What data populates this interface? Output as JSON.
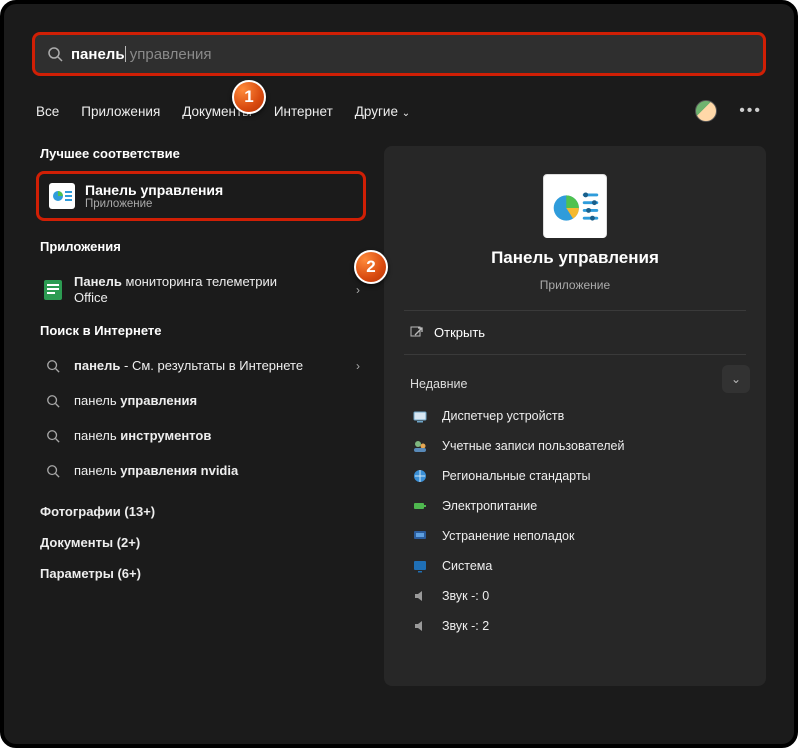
{
  "search": {
    "typed_bold": "панель",
    "typed_rest": "",
    "suggestion_rest": " управления"
  },
  "tabs": {
    "all": "Все",
    "apps": "Приложения",
    "docs": "Документы",
    "web": "Интернет",
    "other": "Другие"
  },
  "left": {
    "best_label": "Лучшее соответствие",
    "best_title_bold": "Панель",
    "best_title_rest": " управления",
    "best_sub": "Приложение",
    "apps_label": "Приложения",
    "app1_bold": "Панель",
    "app1_rest": " мониторинга телеметрии Office",
    "web_label": "Поиск в Интернете",
    "web1_bold": "панель",
    "web1_rest": " - См. результаты в Интернете",
    "web2_pre": "панель ",
    "web2_bold": "управления",
    "web3_pre": "панель ",
    "web3_bold": "инструментов",
    "web4_pre": "панель ",
    "web4_bold": "управления nvidia",
    "cat_photos": "Фотографии (13+)",
    "cat_docs": "Документы (2+)",
    "cat_params": "Параметры (6+)"
  },
  "right": {
    "title": "Панель управления",
    "sub": "Приложение",
    "open": "Открыть",
    "recent_label": "Недавние",
    "recent": [
      "Диспетчер устройств",
      "Учетные записи пользователей",
      "Региональные стандарты",
      "Электропитание",
      "Устранение неполадок",
      "Система",
      "Звук -: 0",
      "Звук -: 2"
    ]
  },
  "badges": {
    "one": "1",
    "two": "2"
  }
}
